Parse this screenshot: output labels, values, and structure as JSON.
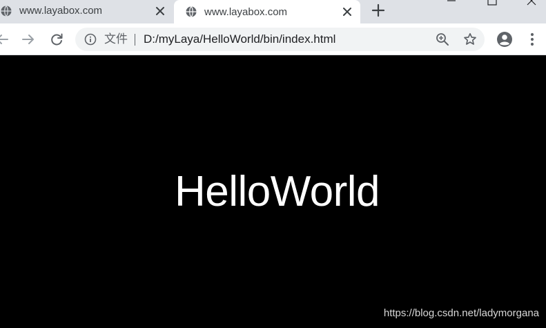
{
  "tabs": [
    {
      "title": "www.layabox.com",
      "active": false
    },
    {
      "title": "www.layabox.com",
      "active": true
    }
  ],
  "toolbar": {
    "security_label": "文件",
    "url": "D:/myLaya/HelloWorld/bin/index.html"
  },
  "content": {
    "text": "HelloWorld",
    "watermark": "https://blog.csdn.net/ladymorgana"
  },
  "colors": {
    "tab_strip": "#dee1e6",
    "omnibox": "#f1f3f4",
    "icon": "#5f6368",
    "page_background": "#000000",
    "page_text": "#ffffff"
  }
}
